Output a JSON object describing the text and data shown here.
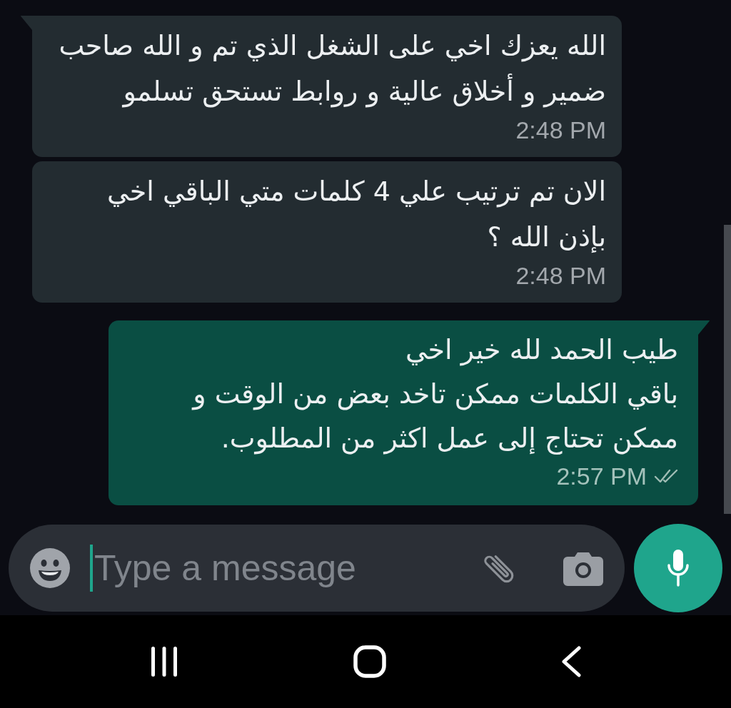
{
  "messages": [
    {
      "kind": "incoming",
      "tail": true,
      "text": "الله يعزك اخي على الشغل الذي تم و الله صاحب ضمير و أخلاق عالية و روابط تستحق تسلمو",
      "time": "2:48 PM"
    },
    {
      "kind": "incoming",
      "tail": false,
      "text": "الان تم ترتيب علي 4 كلمات متي الباقي اخي بإذن الله ؟",
      "time": "2:48 PM"
    },
    {
      "kind": "outgoing",
      "tail": true,
      "text": "طيب الحمد لله خير اخي\nباقي الكلمات ممكن تاخد بعض من الوقت و ممكن تحتاج إلى عمل اكثر من المطلوب.",
      "time": "2:57 PM",
      "delivered": true,
      "read": false
    }
  ],
  "composer": {
    "placeholder": "Type a message"
  }
}
